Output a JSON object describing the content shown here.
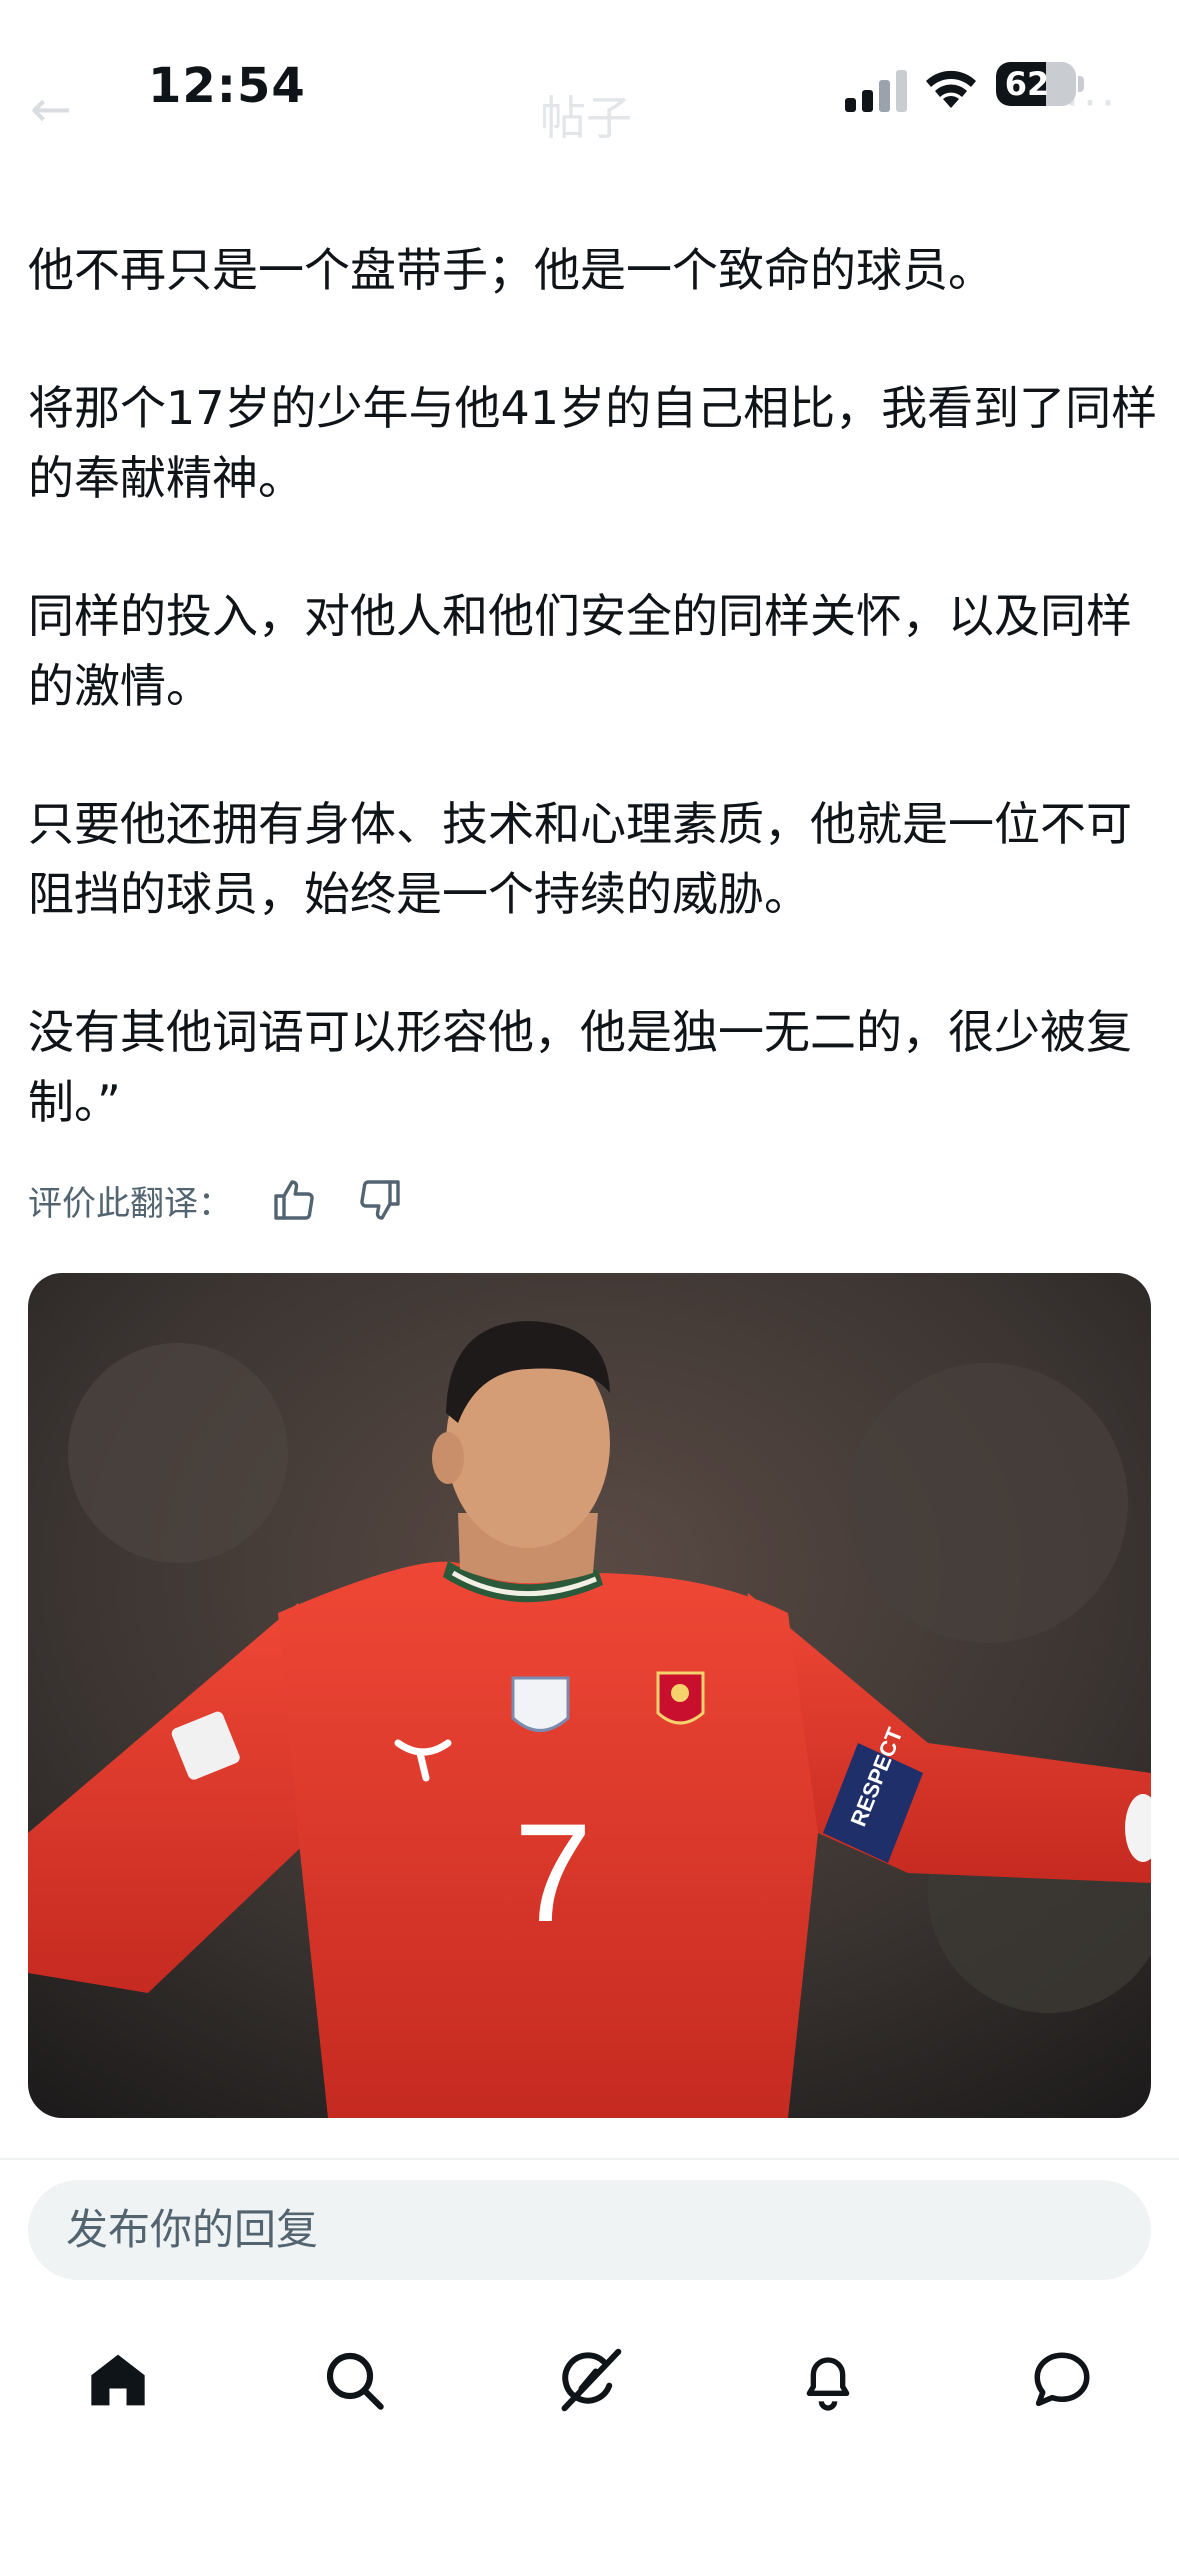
{
  "status_bar": {
    "time": "12:54",
    "battery": "62",
    "battery_level": 0.62
  },
  "header": {
    "back_label": "←",
    "title": "帖子",
    "more_label": "···"
  },
  "post": {
    "paragraphs": [
      "他不再只是一个盘带手；他是一个致命的球员。",
      "将那个17岁的少年与他41岁的自己相比，我看到了同样的奉献精神。",
      "同样的投入，对他人和他们安全的同样关怀，以及同样的激情。",
      "只要他还拥有身体、技术和心理素质，他就是一位不可阻挡的球员，始终是一个持续的威胁。",
      "没有其他词语可以形容他，他是独一无二的，很少被复制。”"
    ],
    "rate_translation_label": "评价此翻译：",
    "image": {
      "jersey_number": "7",
      "armband": "RESPECT"
    }
  },
  "reply": {
    "placeholder": "发布你的回复"
  },
  "nav": {
    "items": [
      {
        "name": "home",
        "icon": "home-icon",
        "active": true
      },
      {
        "name": "search",
        "icon": "search-icon",
        "active": false
      },
      {
        "name": "grok",
        "icon": "grok-icon",
        "active": false
      },
      {
        "name": "notifications",
        "icon": "bell-icon",
        "active": false
      },
      {
        "name": "messages",
        "icon": "chat-icon",
        "active": false
      }
    ]
  },
  "colors": {
    "text": "#0f1419",
    "muted": "#536471",
    "input_bg": "#eff3f4",
    "jersey_red": "#e0362a"
  }
}
